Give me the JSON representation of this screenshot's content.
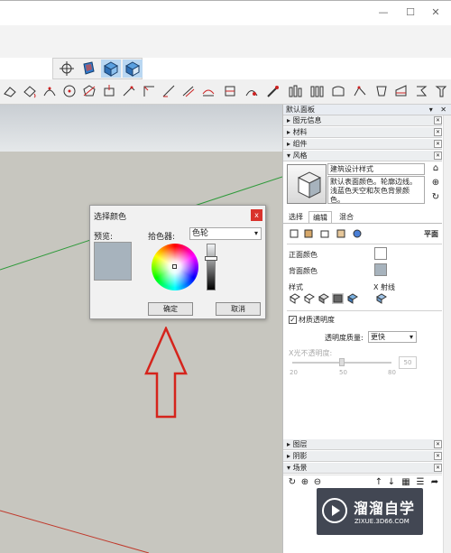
{
  "window": {
    "minimize_glyph": "—",
    "maximize_glyph": "☐",
    "close_glyph": "✕"
  },
  "dialog": {
    "title": "选择颜色",
    "close_glyph": "x",
    "preview_label": "预览:",
    "picker_label": "拾色器:",
    "picker_value": "色轮",
    "ok_label": "确定",
    "cancel_label": "取消",
    "current_color": "#a7b3bd"
  },
  "tray": {
    "title": "默认面板",
    "title_buttons": "▾ ✕",
    "sections": [
      {
        "label": "图元信息",
        "state": "collapsed"
      },
      {
        "label": "材料",
        "state": "collapsed"
      },
      {
        "label": "组件",
        "state": "collapsed"
      },
      {
        "label": "风格",
        "state": "expanded"
      }
    ],
    "style": {
      "name": "建筑设计样式",
      "description": "默认表面颜色。轮廓边线。浅蓝色天空和灰色背景颜色。"
    },
    "tabs": [
      "选择",
      "编辑",
      "混合"
    ],
    "active_tab": "编辑",
    "face_mode_label": "平面",
    "front_color_label": "正面颜色",
    "back_color_label": "背面颜色",
    "front_color": "#ffffff",
    "back_color": "#a7b3bd",
    "style_label": "样式",
    "xray_label": "X 射线",
    "material_transparency_label": "材质透明度",
    "material_transparency_checked": "✓",
    "quality_label": "透明度质量:",
    "quality_value": "更快",
    "xray_opacity_label": "X光不透明度:",
    "xray_ticks": [
      "20",
      "50",
      "80"
    ],
    "xray_value": "50",
    "xray_level": 0.5,
    "lower_sections": [
      {
        "label": "图层",
        "state": "collapsed"
      },
      {
        "label": "阴影",
        "state": "collapsed"
      },
      {
        "label": "场景",
        "state": "expanded"
      }
    ]
  },
  "watermark": {
    "title": "溜溜自学",
    "url": "ZIXUE.3D66.COM"
  }
}
